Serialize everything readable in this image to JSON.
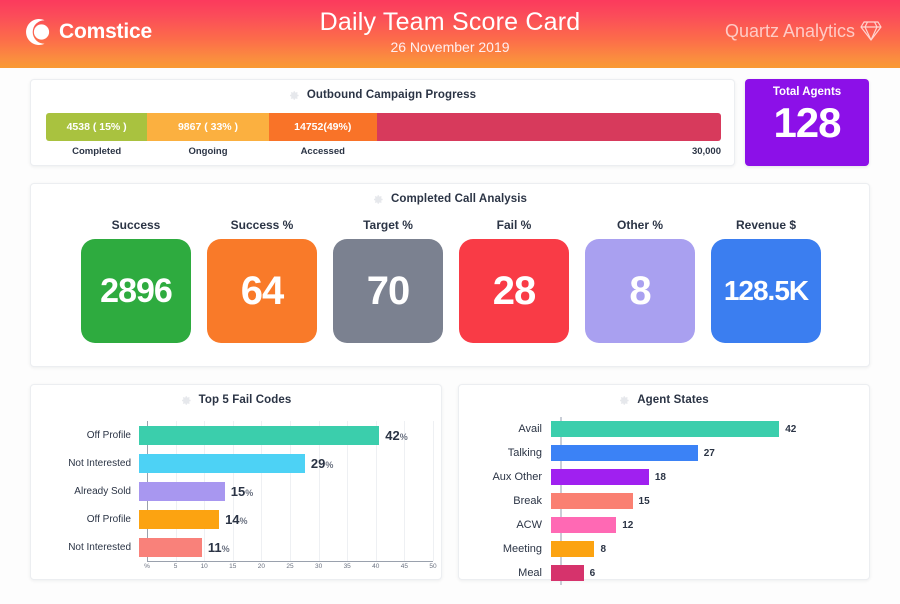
{
  "header": {
    "brand_name": "Comstice",
    "brand_icon": "comstice-crescent-logo",
    "title": "Daily Team Score Card",
    "date": "26 November 2019",
    "vendor_name": "Quartz Analytics",
    "vendor_icon": "diamond-gem-icon",
    "gradient_start": "#fb3a5d",
    "gradient_end": "#f99a33"
  },
  "campaign": {
    "title": "Outbound Campaign Progress",
    "gear_icon": "gear-icon",
    "segments": [
      {
        "label": "4538 ( 15% )",
        "legend": "Completed",
        "percent": 15,
        "color": "#a9c23f"
      },
      {
        "label": "9867 ( 33% )",
        "legend": "Ongoing",
        "percent": 18,
        "color": "#fbb040"
      },
      {
        "label": "14752(49%)",
        "legend": "Accessed",
        "percent": 16,
        "color": "#f97328"
      },
      {
        "label": "",
        "legend": "30,000",
        "percent": 51,
        "color": "#d73a5c"
      }
    ]
  },
  "total_agents": {
    "label": "Total Agents",
    "value": "128",
    "color": "#8c10e8"
  },
  "call_analysis": {
    "title": "Completed Call Analysis",
    "gear_icon": "gear-icon",
    "cards": [
      {
        "label": "Success",
        "value": "2896",
        "color": "#2eab3f",
        "font_size": "34px"
      },
      {
        "label": "Success %",
        "value": "64",
        "color": "#f97a29",
        "font_size": "40px"
      },
      {
        "label": "Target %",
        "value": "70",
        "color": "#7b8190",
        "font_size": "40px"
      },
      {
        "label": "Fail %",
        "value": "28",
        "color": "#f93b46",
        "font_size": "40px"
      },
      {
        "label": "Other %",
        "value": "8",
        "color": "#a9a0f0",
        "font_size": "40px"
      },
      {
        "label": "Revenue $",
        "value": "128.5K",
        "color": "#3b7ef0",
        "font_size": "28px"
      }
    ]
  },
  "chart_data": [
    {
      "type": "bar",
      "orientation": "horizontal",
      "title": "Top 5 Fail Codes",
      "gear_icon": "gear-icon",
      "categories": [
        "Off Profile",
        "Not Interested",
        "Already Sold",
        "Off Profile",
        "Not Interested"
      ],
      "values": [
        42,
        29,
        15,
        14,
        11
      ],
      "value_suffix": "%",
      "colors": [
        "#3bceac",
        "#4dd2f5",
        "#a897f0",
        "#fca311",
        "#f9817a"
      ],
      "xlabel": "",
      "ylabel": "",
      "xlim": [
        0,
        50
      ],
      "xticks": [
        "%",
        "5",
        "10",
        "15",
        "20",
        "25",
        "30",
        "35",
        "40",
        "45",
        "50"
      ],
      "grid": true,
      "legend": "none"
    },
    {
      "type": "bar",
      "orientation": "horizontal",
      "title": "Agent States",
      "gear_icon": "gear-icon",
      "categories": [
        "Avail",
        "Talking",
        "Aux Other",
        "Break",
        "ACW",
        "Meeting",
        "Meal"
      ],
      "values": [
        42,
        27,
        18,
        15,
        12,
        8,
        6
      ],
      "value_suffix": "",
      "colors": [
        "#3bceac",
        "#3b82f6",
        "#a020f0",
        "#fa8072",
        "#ff69b4",
        "#fca311",
        "#d6336c"
      ],
      "xlabel": "",
      "ylabel": "",
      "xlim": [
        0,
        46
      ],
      "xticks": [],
      "grid": false,
      "legend": "none"
    }
  ]
}
